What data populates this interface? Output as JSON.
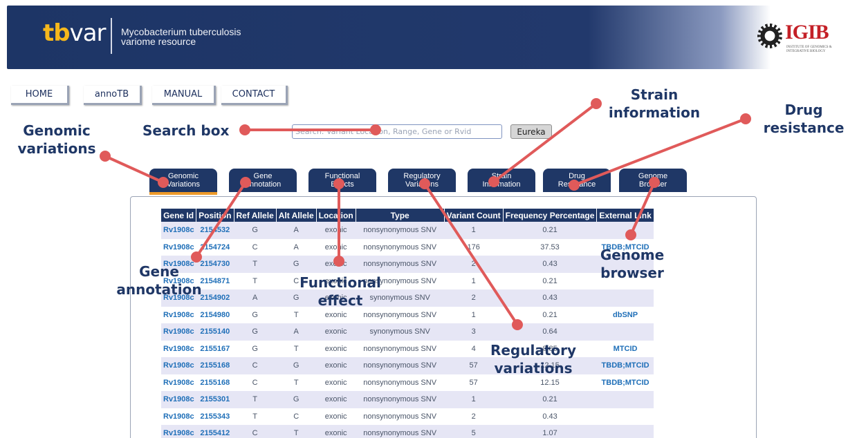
{
  "header": {
    "logo_tb": "tb",
    "logo_var": "var",
    "tagline_line1": "Mycobacterium tuberculosis",
    "tagline_line2": "variome resource",
    "institute_logo": "IGIB",
    "institute_sub": "INSTITUTE OF GENOMICS & INTEGRATIVE BIOLOGY",
    "colors": {
      "banner": "#1d3566",
      "logo_accent": "#f6b81c",
      "igib_red": "#c42027"
    }
  },
  "nav": [
    "HOME",
    "annoTB",
    "MANUAL",
    "CONTACT"
  ],
  "search": {
    "placeholder": "Search: Variant Location, Range, Gene or Rvid",
    "button": "Eureka"
  },
  "tabs": [
    {
      "l1": "Genomic",
      "l2": "Variations",
      "active": true
    },
    {
      "l1": "Gene",
      "l2": "Annotation"
    },
    {
      "l1": "Functional",
      "l2": "Effects"
    },
    {
      "l1": "Regulatory",
      "l2": "Variations"
    },
    {
      "l1": "Strain",
      "l2": "Information"
    },
    {
      "l1": "Drug",
      "l2": "Resistance"
    },
    {
      "l1": "Genome",
      "l2": "Browser"
    }
  ],
  "table": {
    "headers": [
      "Gene Id",
      "Position",
      "Ref Allele",
      "Alt Allele",
      "Location",
      "Type",
      "Variant Count",
      "Frequency Percentage",
      "External Link"
    ],
    "rows": [
      [
        "Rv1908c",
        "2154532",
        "G",
        "A",
        "exonic",
        "nonsynonymous SNV",
        "1",
        "0.21",
        ""
      ],
      [
        "Rv1908c",
        "2154724",
        "C",
        "A",
        "exonic",
        "nonsynonymous SNV",
        "176",
        "37.53",
        "TBDB;MTCID"
      ],
      [
        "Rv1908c",
        "2154730",
        "T",
        "G",
        "exonic",
        "nonsynonymous SNV",
        "2",
        "0.43",
        ""
      ],
      [
        "Rv1908c",
        "2154871",
        "T",
        "C",
        "exonic",
        "nonsynonymous SNV",
        "1",
        "0.21",
        ""
      ],
      [
        "Rv1908c",
        "2154902",
        "A",
        "G",
        "exonic",
        "synonymous SNV",
        "2",
        "0.43",
        ""
      ],
      [
        "Rv1908c",
        "2154980",
        "G",
        "T",
        "exonic",
        "nonsynonymous SNV",
        "1",
        "0.21",
        "dbSNP"
      ],
      [
        "Rv1908c",
        "2155140",
        "G",
        "A",
        "exonic",
        "synonymous SNV",
        "3",
        "0.64",
        ""
      ],
      [
        "Rv1908c",
        "2155167",
        "G",
        "T",
        "exonic",
        "nonsynonymous SNV",
        "4",
        "0.85",
        "MTCID"
      ],
      [
        "Rv1908c",
        "2155168",
        "C",
        "G",
        "exonic",
        "nonsynonymous SNV",
        "57",
        "12.15",
        "TBDB;MTCID"
      ],
      [
        "Rv1908c",
        "2155168",
        "C",
        "T",
        "exonic",
        "nonsynonymous SNV",
        "57",
        "12.15",
        "TBDB;MTCID"
      ],
      [
        "Rv1908c",
        "2155301",
        "T",
        "G",
        "exonic",
        "nonsynonymous SNV",
        "1",
        "0.21",
        ""
      ],
      [
        "Rv1908c",
        "2155343",
        "T",
        "C",
        "exonic",
        "nonsynonymous SNV",
        "2",
        "0.43",
        ""
      ],
      [
        "Rv1908c",
        "2155412",
        "C",
        "T",
        "exonic",
        "nonsynonymous SNV",
        "5",
        "1.07",
        ""
      ]
    ]
  },
  "annotations": {
    "genomic": "Genomic variations",
    "search": "Search box",
    "strain": "Strain information",
    "drug": "Drug resistance",
    "gene": "Gene annotation",
    "functional": "Functional effect",
    "genome": "Genome browser",
    "regulatory": "Regulatory variations",
    "color_arrow": "#e05a5a",
    "color_label": "#1f3766"
  }
}
